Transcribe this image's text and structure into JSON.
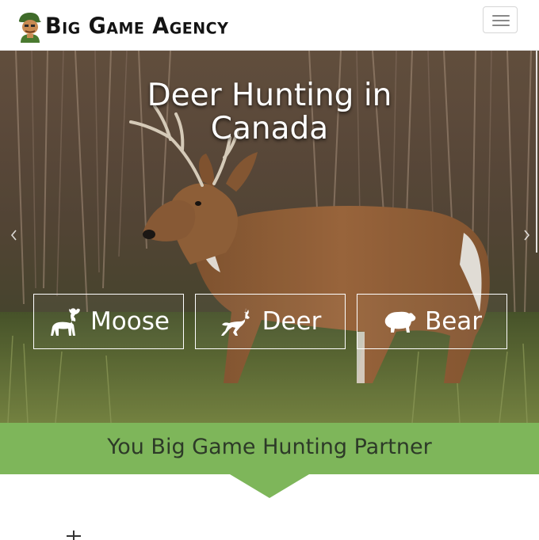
{
  "header": {
    "brand": "Big Game Agency",
    "menu_toggle": "menu-icon"
  },
  "hero": {
    "title_line1": "Deer Hunting in",
    "title_line2": "Canada",
    "prev_icon": "chevron-left-icon",
    "next_icon": "chevron-right-icon",
    "species": [
      {
        "label": "Moose",
        "icon": "moose-icon"
      },
      {
        "label": "Deer",
        "icon": "deer-icon"
      },
      {
        "label": "Bear",
        "icon": "bear-icon"
      }
    ]
  },
  "band": {
    "tagline": "You Big Game Hunting Partner",
    "color": "#7eb65a"
  }
}
